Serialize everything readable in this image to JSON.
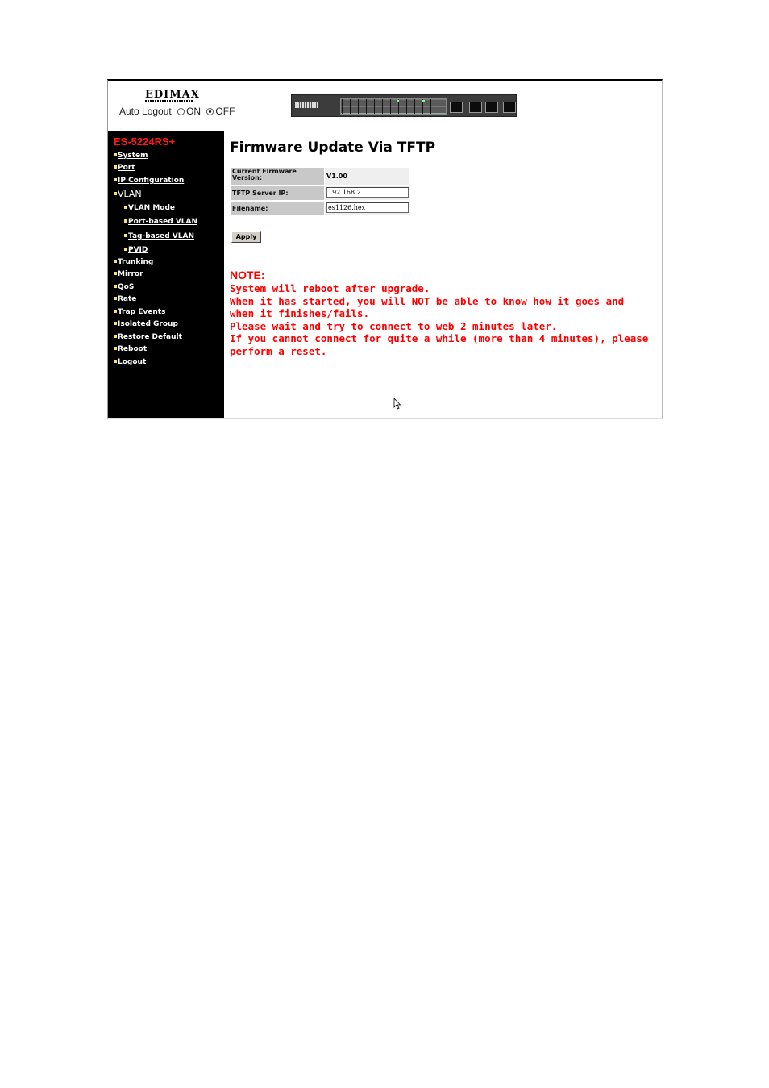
{
  "header": {
    "logo": "EDIMAX",
    "auto_logout_label": "Auto Logout",
    "auto_logout_on": "ON",
    "auto_logout_off": "OFF"
  },
  "sidebar": {
    "model": "ES-5224RS+",
    "items": [
      {
        "label": "System"
      },
      {
        "label": "Port"
      },
      {
        "label": "IP Configuration"
      },
      {
        "label": "VLAN"
      },
      {
        "label": "VLAN Mode"
      },
      {
        "label": "Port-based VLAN"
      },
      {
        "label": "Tag-based VLAN"
      },
      {
        "label": "PVID"
      },
      {
        "label": "Trunking"
      },
      {
        "label": "Mirror"
      },
      {
        "label": "QoS"
      },
      {
        "label": "Rate"
      },
      {
        "label": "Trap Events"
      },
      {
        "label": "Isolated Group"
      },
      {
        "label": "Restore Default"
      },
      {
        "label": "Reboot"
      },
      {
        "label": "Logout"
      }
    ]
  },
  "main": {
    "title": "Firmware Update Via TFTP",
    "form": {
      "firmware_label": "Current Firmware Version:",
      "firmware_value": "V1.00",
      "server_label": "TFTP Server IP:",
      "server_value": "192.168.2.",
      "filename_label": "Filename:",
      "filename_value": "es1126.hex"
    },
    "apply_label": "Apply",
    "note": {
      "heading": "NOTE:",
      "lines": [
        "System will reboot after upgrade.",
        "When it has started, you will NOT be able to know how it goes and",
        "when it finishes/fails.",
        "Please wait and try to connect to web 2 minutes later.",
        "If you cannot connect for quite a while (more than 4 minutes), please",
        "perform a reset."
      ]
    }
  },
  "colors": {
    "sidebar_bg": "#000000",
    "model_text": "#ff1a1a",
    "note_text": "#ff0000",
    "label_bg": "#c8c8c8"
  }
}
